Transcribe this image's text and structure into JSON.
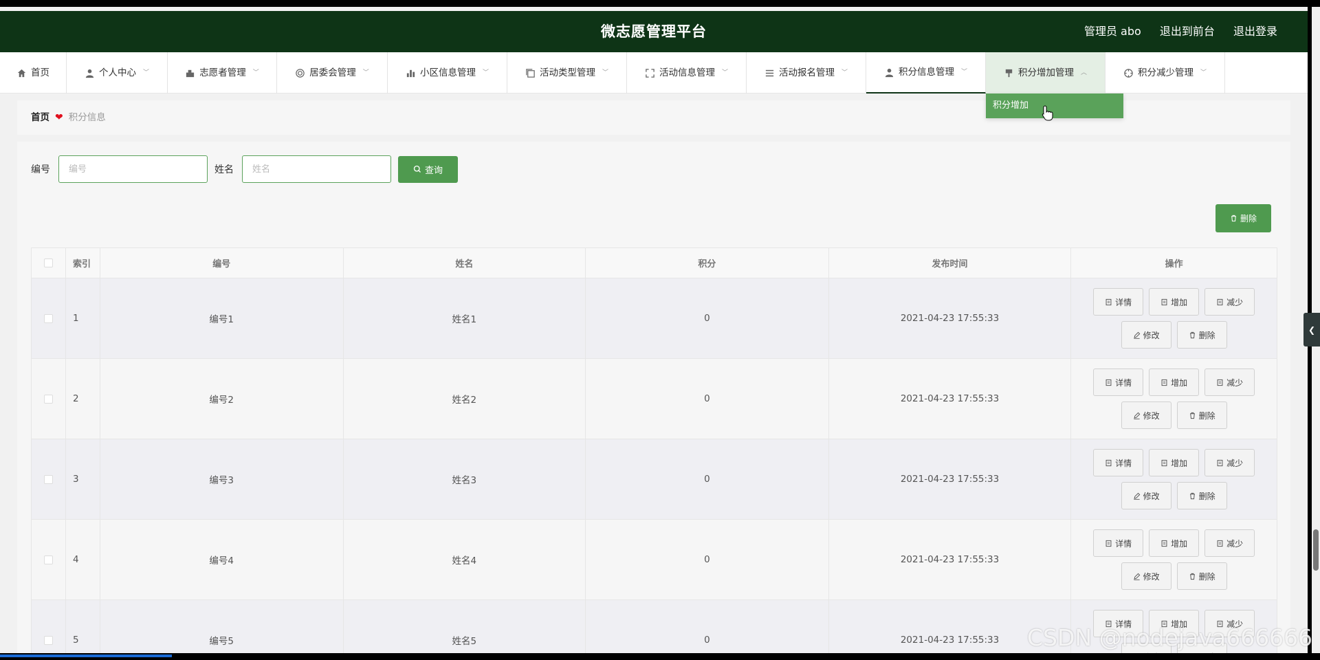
{
  "header": {
    "title": "微志愿管理平台",
    "links": [
      "管理员 abo",
      "退出到前台",
      "退出登录"
    ]
  },
  "nav": {
    "items": [
      {
        "label": "首页",
        "icon": "home-icon",
        "has_chevron": false
      },
      {
        "label": "个人中心",
        "icon": "user-icon",
        "has_chevron": true
      },
      {
        "label": "志愿者管理",
        "icon": "volunteer-icon",
        "has_chevron": true
      },
      {
        "label": "居委会管理",
        "icon": "target-icon",
        "has_chevron": true
      },
      {
        "label": "小区信息管理",
        "icon": "bar-chart-icon",
        "has_chevron": true
      },
      {
        "label": "活动类型管理",
        "icon": "copy-icon",
        "has_chevron": true
      },
      {
        "label": "活动信息管理",
        "icon": "fullscreen-icon",
        "has_chevron": true
      },
      {
        "label": "活动报名管理",
        "icon": "list-icon",
        "has_chevron": true
      },
      {
        "label": "积分信息管理",
        "icon": "person-icon",
        "has_chevron": true,
        "active": true
      },
      {
        "label": "积分增加管理",
        "icon": "brush-icon",
        "has_chevron": true,
        "open": true
      },
      {
        "label": "积分减少管理",
        "icon": "compass-icon",
        "has_chevron": true
      }
    ],
    "dropdown_item": "积分增加"
  },
  "breadcrumb": {
    "home": "首页",
    "current": "积分信息"
  },
  "search": {
    "no_label": "编号",
    "no_placeholder": "编号",
    "name_label": "姓名",
    "name_placeholder": "姓名",
    "query_button": "查询"
  },
  "toolbar": {
    "delete_button": "删除"
  },
  "table": {
    "columns": [
      "索引",
      "编号",
      "姓名",
      "积分",
      "发布时间",
      "操作"
    ],
    "rows": [
      {
        "index": "1",
        "no": "编号1",
        "name": "姓名1",
        "score": "0",
        "time": "2021-04-23 17:55:33"
      },
      {
        "index": "2",
        "no": "编号2",
        "name": "姓名2",
        "score": "0",
        "time": "2021-04-23 17:55:33"
      },
      {
        "index": "3",
        "no": "编号3",
        "name": "姓名3",
        "score": "0",
        "time": "2021-04-23 17:55:33"
      },
      {
        "index": "4",
        "no": "编号4",
        "name": "姓名4",
        "score": "0",
        "time": "2021-04-23 17:55:33"
      },
      {
        "index": "5",
        "no": "编号5",
        "name": "姓名5",
        "score": "0",
        "time": "2021-04-23 17:55:33"
      }
    ],
    "row_actions": [
      "详情",
      "增加",
      "减少",
      "修改",
      "删除"
    ]
  },
  "watermark": "CSDN @nodejava666666",
  "colors": {
    "header_bg": "#0e3416",
    "accent": "#4f9a4f",
    "dropdown_bg": "#5aa25a"
  }
}
